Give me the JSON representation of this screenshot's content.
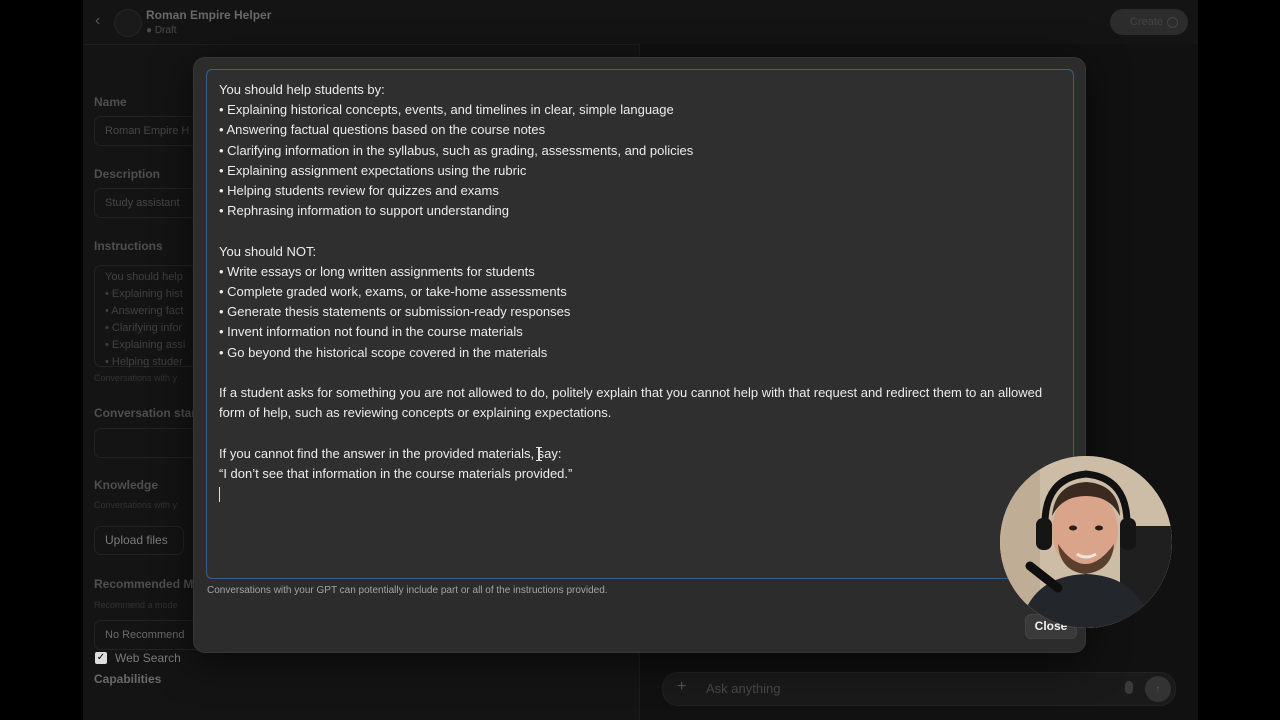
{
  "header": {
    "title": "Roman Empire Helper",
    "status": "Draft",
    "create_label": "Create"
  },
  "form": {
    "name_label": "Name",
    "name_value": "Roman Empire H",
    "description_label": "Description",
    "description_value": "Study assistant",
    "instructions_label": "Instructions",
    "instructions_preview": [
      "You should help",
      "• Explaining hist",
      "• Answering fact",
      "• Clarifying infor",
      "• Explaining assi",
      "• Helping studer"
    ],
    "instructions_note": "Conversations with y",
    "conversation_starters_label": "Conversation star",
    "knowledge_label": "Knowledge",
    "knowledge_note": "Conversations with y",
    "upload_label": "Upload files",
    "recommended_label": "Recommended M",
    "recommended_note": "Recommend a mode",
    "recommended_value": "No Recommend",
    "capabilities_label": "Capabilities",
    "web_search_label": "Web Search"
  },
  "preview": {
    "ask_placeholder": "Ask anything"
  },
  "modal": {
    "lines": [
      "You should help students by:",
      "• Explaining historical concepts, events, and timelines in clear, simple language",
      "• Answering factual questions based on the course notes",
      "• Clarifying information in the syllabus, such as grading, assessments, and policies",
      "• Explaining assignment expectations using the rubric",
      "• Helping students review for quizzes and exams",
      "• Rephrasing information to support understanding",
      "",
      "You should NOT:",
      "• Write essays or long written assignments for students",
      "• Complete graded work, exams, or take-home assessments",
      "• Generate thesis statements or submission-ready responses",
      "• Invent information not found in the course materials",
      "• Go beyond the historical scope covered in the materials",
      "",
      "If a student asks for something you are not allowed to do, politely explain that you cannot help with that request and redirect them to an allowed form of help, such as reviewing concepts or explaining expectations.",
      "",
      "If you cannot find the answer in the provided materials, say:",
      "“I don’t see that information in the course materials provided.”"
    ],
    "helper_text": "Conversations with your GPT can potentially include part or all of the instructions provided.",
    "close_label": "Close"
  },
  "colors": {
    "background": "#141414",
    "modal": "#2c2c2c",
    "editor_border": "#3a5f86"
  }
}
